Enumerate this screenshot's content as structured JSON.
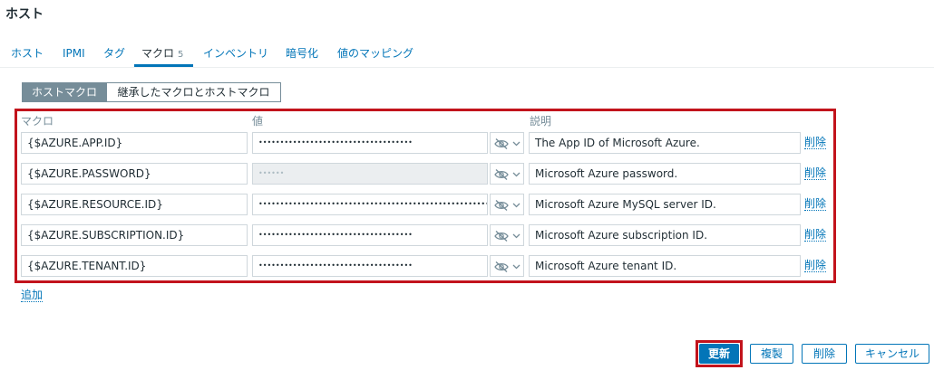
{
  "page": {
    "title": "ホスト"
  },
  "tabs": [
    {
      "label": "ホスト"
    },
    {
      "label": "IPMI"
    },
    {
      "label": "タグ"
    },
    {
      "label": "マクロ",
      "count": "5"
    },
    {
      "label": "インベントリ"
    },
    {
      "label": "暗号化"
    },
    {
      "label": "値のマッピング"
    }
  ],
  "active_tab": "マクロ",
  "macro_mode": {
    "host_label": "ホストマクロ",
    "inherited_label": "継承したマクロとホストマクロ",
    "selected": "ホストマクロ"
  },
  "columns": {
    "macro": "マクロ",
    "value": "値",
    "description": "説明"
  },
  "macros": [
    {
      "macro": "{$AZURE.APP.ID}",
      "value": "••••••••••••••••••••••••••••••••••••",
      "description": "The App ID of Microsoft Azure.",
      "value_disabled": false,
      "remove_label": "削除"
    },
    {
      "macro": "{$AZURE.PASSWORD}",
      "value": "••••••",
      "description": "Microsoft Azure password.",
      "value_disabled": true,
      "remove_label": "削除"
    },
    {
      "macro": "{$AZURE.RESOURCE.ID}",
      "value": "•••••••••••••••••••••••••••••••••••••••••••••••••••••••",
      "description": "Microsoft Azure MySQL server ID.",
      "value_disabled": false,
      "remove_label": "削除"
    },
    {
      "macro": "{$AZURE.SUBSCRIPTION.ID}",
      "value": "••••••••••••••••••••••••••••••••••••",
      "description": "Microsoft Azure subscription ID.",
      "value_disabled": false,
      "remove_label": "削除"
    },
    {
      "macro": "{$AZURE.TENANT.ID}",
      "value": "••••••••••••••••••••••••••••••••••••",
      "description": "Microsoft Azure tenant ID.",
      "value_disabled": false,
      "remove_label": "削除"
    }
  ],
  "value_type_icon": "eye-slash-icon",
  "add_label": "追加",
  "buttons": {
    "update": "更新",
    "clone": "複製",
    "delete": "削除",
    "cancel": "キャンセル"
  },
  "colors": {
    "accent": "#0275b8",
    "highlight": "#c2131c",
    "segment_active": "#768d99"
  }
}
